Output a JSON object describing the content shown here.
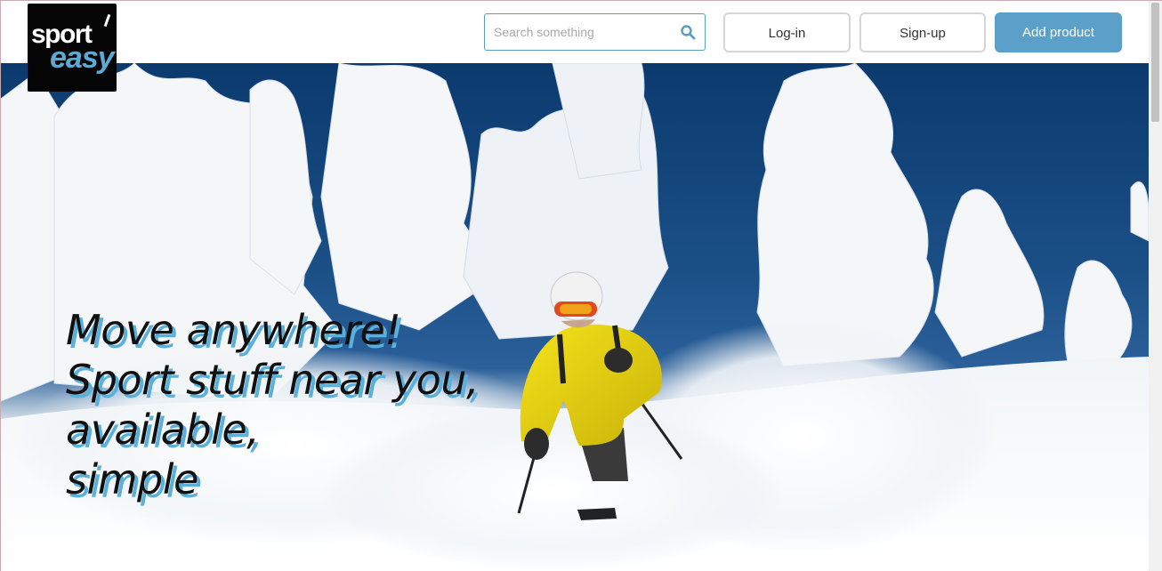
{
  "header": {
    "logo": {
      "line1": "sport",
      "line2": "easy",
      "colors": {
        "background": "#050505",
        "line1": "#ffffff",
        "line2": "#5aaad5"
      }
    },
    "search": {
      "placeholder": "Search something",
      "value": "",
      "icon": "search-icon"
    },
    "buttons": {
      "login": "Log-in",
      "signup": "Sign-up",
      "add_product": "Add product"
    },
    "colors": {
      "accent": "#5aa0c8"
    }
  },
  "hero": {
    "image": "skier-in-snowy-forest",
    "tagline": [
      "Move anywhere!",
      "Sport stuff near you,",
      "available,",
      "simple"
    ],
    "colors": {
      "text": "#111111",
      "shadow": "#5ab0dd",
      "sky": "#0b3a6e"
    }
  }
}
